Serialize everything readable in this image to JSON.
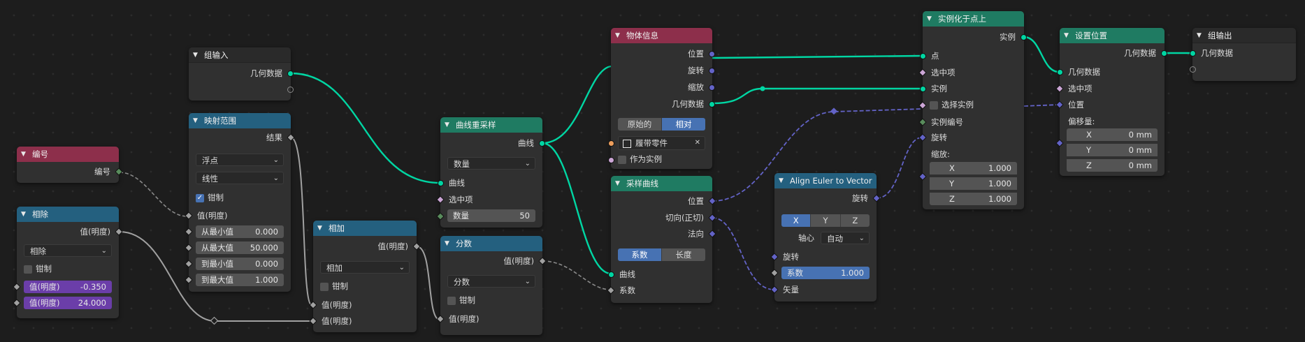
{
  "nodes": {
    "index": {
      "title": "编号",
      "out_label": "编号"
    },
    "divide": {
      "title": "相除",
      "out_label": "值(明度)",
      "op": "相除",
      "clamp_label": "钳制",
      "a_label": "值(明度)",
      "a_value": "-0.350",
      "b_label": "值(明度)",
      "b_value": "24.000"
    },
    "group_input": {
      "title": "组输入",
      "out_label": "几何数据"
    },
    "map_range": {
      "title": "映射范围",
      "out_label": "结果",
      "type": "浮点",
      "interp": "线性",
      "clamp_label": "钳制",
      "value_label": "值(明度)",
      "from_min_label": "从最小值",
      "from_min": "0.000",
      "from_max_label": "从最大值",
      "from_max": "50.000",
      "to_min_label": "到最小值",
      "to_min": "0.000",
      "to_max_label": "到最大值",
      "to_max": "1.000"
    },
    "add": {
      "title": "相加",
      "out_label": "值(明度)",
      "op": "相加",
      "clamp_label": "钳制",
      "in_a": "值(明度)",
      "in_b": "值(明度)"
    },
    "resample": {
      "title": "曲线重采样",
      "out_label": "曲线",
      "mode": "数量",
      "in_curve": "曲线",
      "in_selection": "选中项",
      "count_label": "数量",
      "count": "50"
    },
    "fraction": {
      "title": "分数",
      "out_label": "值(明度)",
      "op": "分数",
      "clamp_label": "钳制",
      "in_label": "值(明度)"
    },
    "object_info": {
      "title": "物体信息",
      "out_location": "位置",
      "out_rotation": "旋转",
      "out_scale": "缩放",
      "out_geometry": "几何数据",
      "mode_original": "原始的",
      "mode_relative": "相对",
      "object_name": "履带零件",
      "as_instance": "作为实例"
    },
    "sample_curve": {
      "title": "采样曲线",
      "out_position": "位置",
      "out_tangent": "切向(正切)",
      "out_normal": "法向",
      "mode_factor": "系数",
      "mode_length": "长度",
      "in_curve": "曲线",
      "in_factor": "系数"
    },
    "align_euler": {
      "title": "Align Euler to Vector",
      "out_label": "旋转",
      "axis_x": "X",
      "axis_y": "Y",
      "axis_z": "Z",
      "pivot_label": "轴心",
      "pivot_value": "自动",
      "in_rotation": "旋转",
      "factor_label": "系数",
      "factor": "1.000",
      "in_vector": "矢量"
    },
    "instance_on_points": {
      "title": "实例化于点上",
      "out_label": "实例",
      "in_points": "点",
      "in_selection": "选中项",
      "in_instance": "实例",
      "pick_instance": "选择实例",
      "in_instance_index": "实例编号",
      "in_rotation": "旋转",
      "scale_label": "缩放:",
      "sx_label": "X",
      "sx": "1.000",
      "sy_label": "Y",
      "sy": "1.000",
      "sz_label": "Z",
      "sz": "1.000"
    },
    "set_position": {
      "title": "设置位置",
      "out_label": "几何数据",
      "in_geometry": "几何数据",
      "in_selection": "选中项",
      "in_position": "位置",
      "offset_label": "偏移量:",
      "ox_label": "X",
      "ox": "0 mm",
      "oy_label": "Y",
      "oy": "0 mm",
      "oz_label": "Z",
      "oz": "0 mm"
    },
    "group_output": {
      "title": "组输出",
      "in_label": "几何数据"
    }
  },
  "colors": {
    "geometry_wire": "#00d6a3",
    "vector_wire": "#6363c7",
    "float_wire": "#a1a1a1",
    "header_geometry": "#1f7b62",
    "header_converter": "#24607f",
    "header_info": "#8d2f4b",
    "accent_blue": "#4772b3",
    "purple_field": "#6b3ea9"
  }
}
